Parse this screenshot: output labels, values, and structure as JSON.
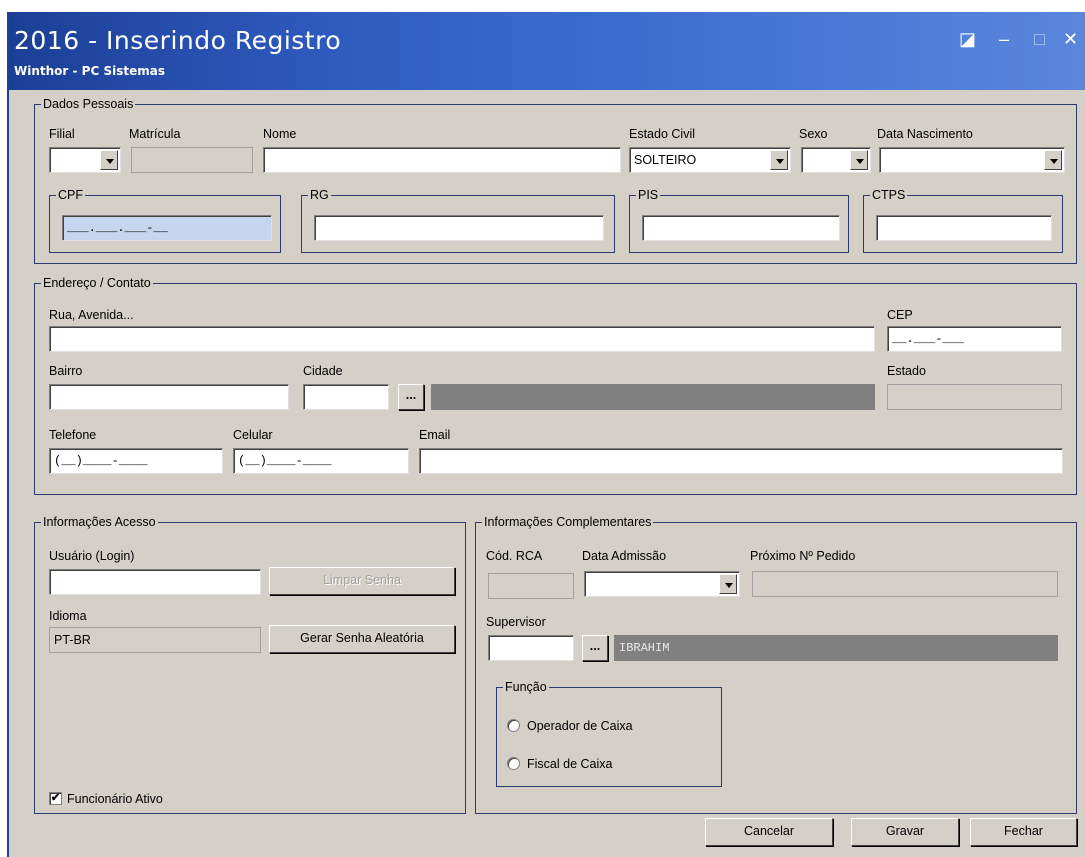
{
  "window": {
    "title": "2016 - Inserindo Registro",
    "subtitle": "Winthor - PC Sistemas",
    "controls": [
      "◪",
      "–",
      "□",
      "✕"
    ]
  },
  "dados_pessoais": {
    "legend": "Dados Pessoais",
    "filial_label": "Filial",
    "matricula_label": "Matrícula",
    "nome_label": "Nome",
    "estado_civil_label": "Estado Civil",
    "estado_civil_value": "SOLTEIRO",
    "sexo_label": "Sexo",
    "data_nascimento_label": "Data Nascimento",
    "cpf_legend": "CPF",
    "cpf_mask": "___.___.___-__",
    "rg_legend": "RG",
    "pis_legend": "PIS",
    "ctps_legend": "CTPS"
  },
  "endereco": {
    "legend": "Endereço / Contato",
    "rua_label": "Rua, Avenida...",
    "cep_label": "CEP",
    "cep_mask": "__.___-___",
    "bairro_label": "Bairro",
    "cidade_label": "Cidade",
    "cidade_button": "...",
    "estado_label": "Estado",
    "telefone_label": "Telefone",
    "telefone_mask": "(__)____-____",
    "celular_label": "Celular",
    "celular_mask": "(__)____-____",
    "email_label": "Email"
  },
  "acesso": {
    "legend": "Informações Acesso",
    "usuario_label": "Usuário (Login)",
    "limpar_senha": "Limpar Senha",
    "idioma_label": "Idioma",
    "idioma_value": "PT-BR",
    "gerar_senha": "Gerar Senha Aleatória",
    "funcionario_ativo": "Funcionário Ativo",
    "funcionario_checked": "✔"
  },
  "complementares": {
    "legend": "Informações Complementares",
    "cod_rca_label": "Cód. RCA",
    "data_admissao_label": "Data Admissão",
    "proximo_pedido_label": "Próximo Nº Pedido",
    "supervisor_label": "Supervisor",
    "supervisor_button": "...",
    "supervisor_name": "IBRAHIM",
    "funcao_legend": "Função",
    "funcao_options": [
      "Operador de Caixa",
      "Fiscal de Caixa"
    ]
  },
  "footer": {
    "cancelar": "Cancelar",
    "gravar": "Gravar",
    "fechar": "Fechar"
  }
}
